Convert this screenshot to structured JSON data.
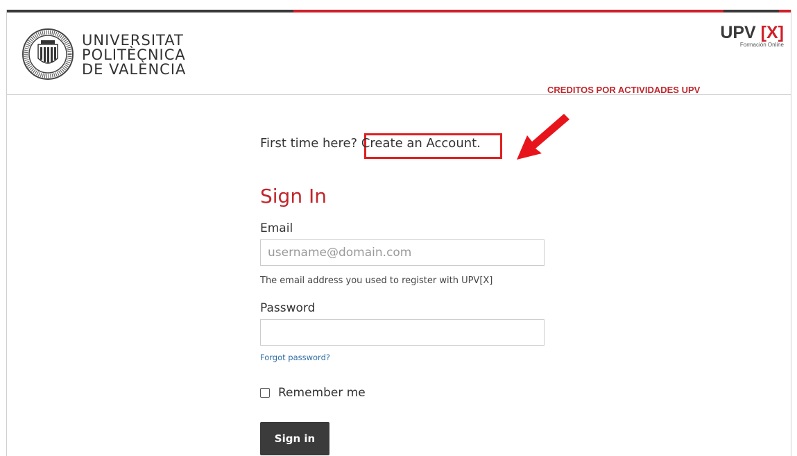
{
  "header": {
    "university_name": [
      "UNIVERSITAT",
      "POLITÈCNICA",
      "DE VALÈNCIA"
    ],
    "upvx_logo_main": "UPV ",
    "upvx_logo_bracket": "[X]",
    "upvx_subtitle": "Formación Online",
    "credits_link": "CREDITOS POR ACTIVIDADES UPV",
    "colors": {
      "brand_red": "#d0202a",
      "dark_bar": "#3a3a3a"
    }
  },
  "login": {
    "first_time_prefix": "First time here? ",
    "create_account_link": "Create an Account.",
    "title": "Sign In",
    "email_label": "Email",
    "email_placeholder": "username@domain.com",
    "email_value": "",
    "email_help": "The email address you used to register with UPV[X]",
    "password_label": "Password",
    "password_value": "",
    "forgot_password": "Forgot password?",
    "remember_me": "Remember me",
    "remember_checked": false,
    "submit_label": "Sign in"
  },
  "annotation": {
    "highlight_color": "#e02020",
    "arrow_icon": "red-arrow-icon"
  }
}
